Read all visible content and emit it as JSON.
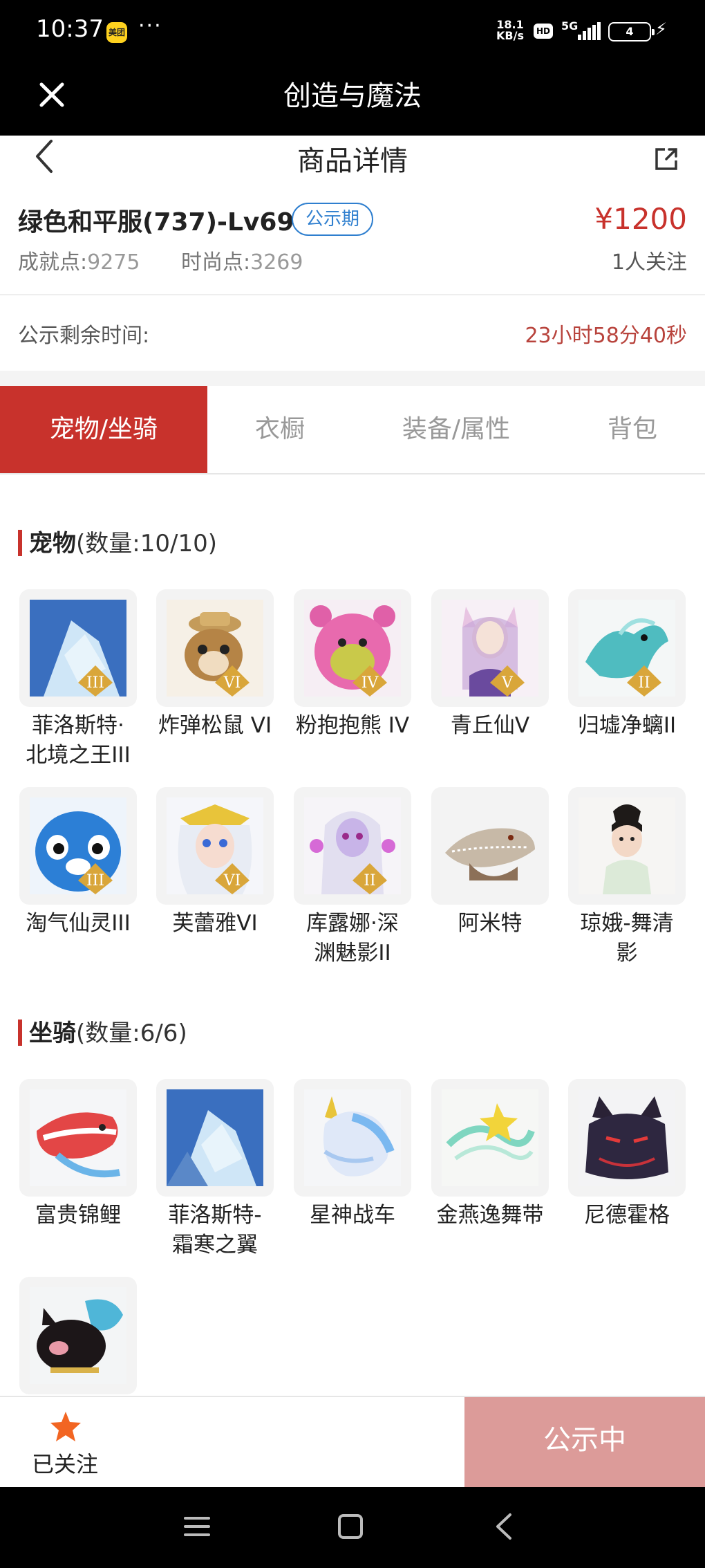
{
  "status_bar": {
    "time": "10:37",
    "app_icon_label": "美团",
    "dots": "···",
    "net_speed_top": "18.1",
    "net_speed_bottom": "KB/s",
    "hd": "HD",
    "network": "5G",
    "battery": "4"
  },
  "app_bar": {
    "title": "创造与魔法",
    "close_icon": "close-icon"
  },
  "page_header": {
    "title": "商品详情",
    "back_icon": "chevron-left-icon",
    "share_icon": "share-icon"
  },
  "product": {
    "title": "绿色和平服(737)-Lv69",
    "badge": "公示期",
    "price": "¥1200",
    "achievement_label": "成就点:",
    "achievement_value": "9275",
    "fashion_label": "时尚点:",
    "fashion_value": "3269",
    "followers": "1人关注"
  },
  "countdown": {
    "label": "公示剩余时间:",
    "value": "23小时58分40秒"
  },
  "tabs": [
    {
      "label": "宠物/坐骑",
      "active": true
    },
    {
      "label": "衣橱",
      "active": false
    },
    {
      "label": "装备/属性",
      "active": false
    },
    {
      "label": "背包",
      "active": false
    }
  ],
  "pets": {
    "title": "宠物",
    "count": "(数量:10/10)",
    "items": [
      {
        "name": "菲洛斯特·北境之王III",
        "line1": "菲洛斯特·",
        "line2": "北境之王III",
        "badge": "III"
      },
      {
        "name": "炸弹松鼠 VI",
        "line1": "炸弹松鼠 VI",
        "line2": "",
        "badge": "VI"
      },
      {
        "name": "粉抱抱熊 IV",
        "line1": "粉抱抱熊 IV",
        "line2": "",
        "badge": "IV"
      },
      {
        "name": "青丘仙V",
        "line1": "青丘仙V",
        "line2": "",
        "badge": "V"
      },
      {
        "name": "归墟净螭II",
        "line1": "归墟净螭II",
        "line2": "",
        "badge": "II"
      },
      {
        "name": "淘气仙灵III",
        "line1": "淘气仙灵III",
        "line2": "",
        "badge": "III"
      },
      {
        "name": "芙蕾雅VI",
        "line1": "芙蕾雅VI",
        "line2": "",
        "badge": "VI"
      },
      {
        "name": "库露娜·深渊魅影II",
        "line1": "库露娜·深",
        "line2": "渊魅影II",
        "badge": "II"
      },
      {
        "name": "阿米特",
        "line1": "阿米特",
        "line2": "",
        "badge": ""
      },
      {
        "name": "琼娥-舞清影",
        "line1": "琼娥-舞清",
        "line2": "影",
        "badge": ""
      }
    ]
  },
  "mounts": {
    "title": "坐骑",
    "count": "(数量:6/6)",
    "items": [
      {
        "name": "富贵锦鲤",
        "line1": "富贵锦鲤",
        "line2": ""
      },
      {
        "name": "菲洛斯特-霜寒之翼",
        "line1": "菲洛斯特-",
        "line2": "霜寒之翼"
      },
      {
        "name": "星神战车",
        "line1": "星神战车",
        "line2": ""
      },
      {
        "name": "金燕逸舞带",
        "line1": "金燕逸舞带",
        "line2": ""
      },
      {
        "name": "尼德霍格",
        "line1": "尼德霍格",
        "line2": ""
      },
      {
        "name": "",
        "line1": "",
        "line2": ""
      }
    ]
  },
  "action_bar": {
    "follow_label": "已关注",
    "status_button": "公示中"
  },
  "colors": {
    "accent": "#c8322c",
    "badge_blue": "#2f7fcf",
    "button_disabled": "#dc9b99",
    "star": "#f26522"
  }
}
